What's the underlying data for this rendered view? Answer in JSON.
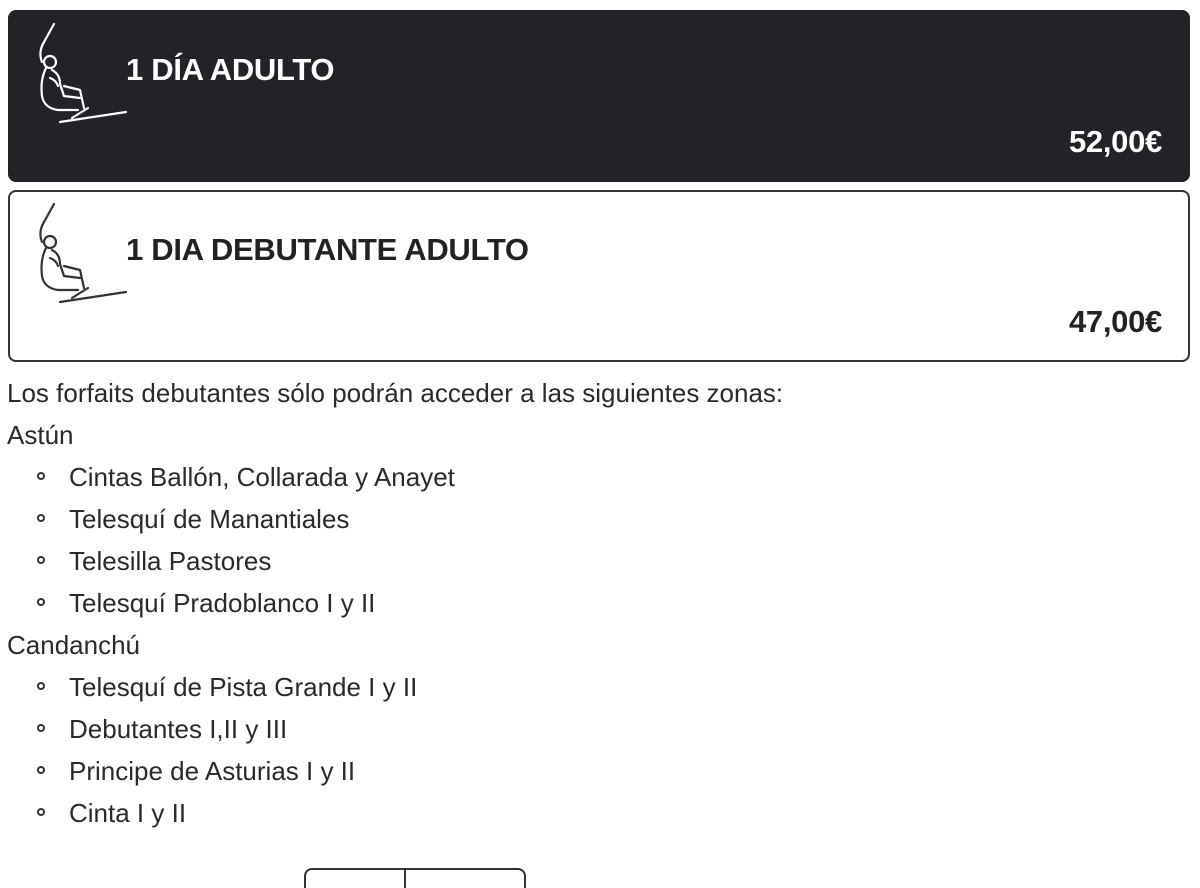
{
  "products": [
    {
      "name": "1 DÍA ADULTO",
      "price": "52,00€",
      "icon": "chairlift-skier-icon",
      "selected": true
    },
    {
      "name": "1 DIA DEBUTANTE ADULTO",
      "price": "47,00€",
      "icon": "chairlift-skier-icon",
      "selected": false
    }
  ],
  "info": {
    "intro": "Los forfaits debutantes sólo podrán acceder a las siguientes zonas:",
    "groups": [
      {
        "title": "Astún",
        "items": [
          "Cintas Ballón, Collarada y Anayet",
          "Telesquí de Manantiales",
          "Telesilla Pastores",
          "Telesquí Pradoblanco I y II"
        ]
      },
      {
        "title": "Candanchú",
        "items": [
          "Telesquí de Pista Grande I y II",
          "Debutantes I,II y III",
          "Principe de Asturias I y II",
          "Cinta I y II"
        ]
      }
    ]
  },
  "colors": {
    "selected_card_bg": "#222327",
    "card_border": "#333333",
    "text": "#222222"
  }
}
